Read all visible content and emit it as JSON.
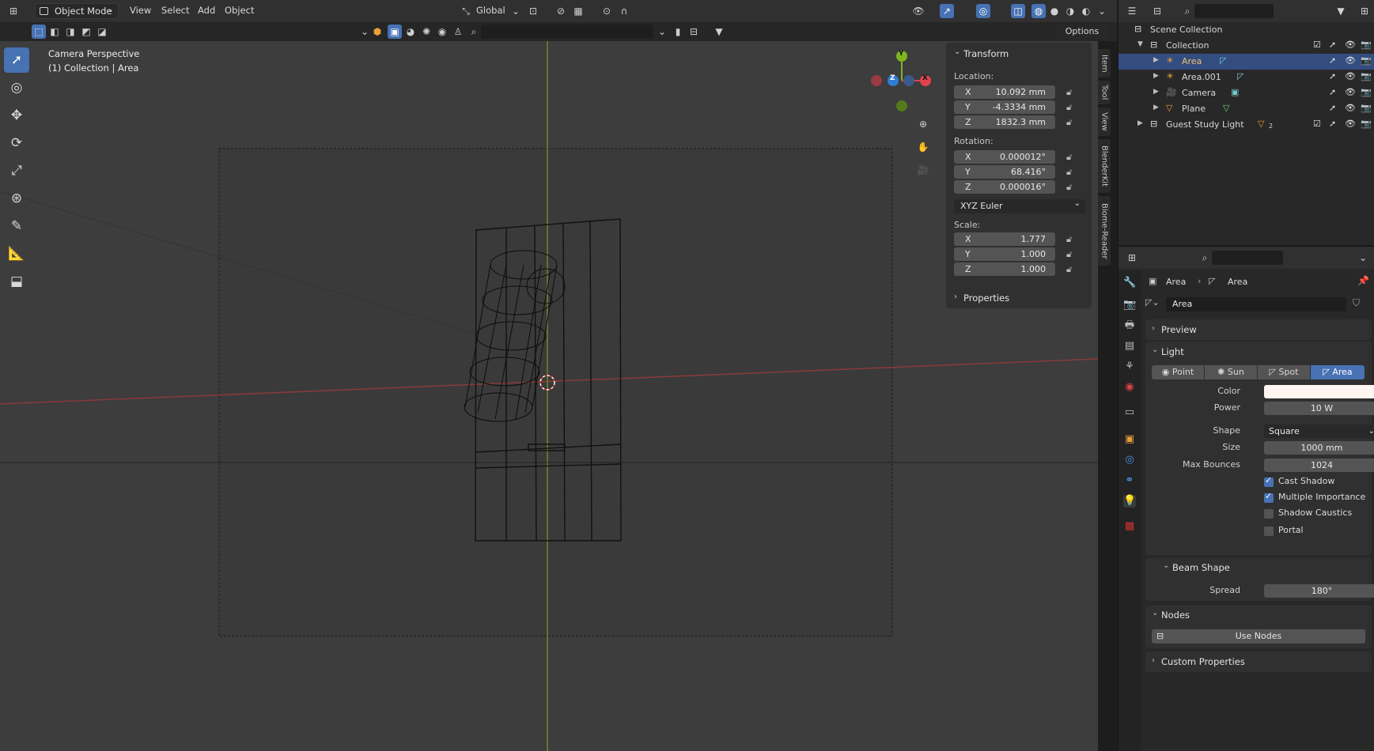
{
  "header": {
    "mode": "Object Mode",
    "menus": [
      "View",
      "Select",
      "Add",
      "Object"
    ],
    "orientation": "Global",
    "options": "Options"
  },
  "viewport": {
    "camera_label": "Camera Perspective",
    "collection_label": "(1) Collection | Area",
    "gizmo": {
      "y": "Y",
      "z": "Z",
      "x": "X"
    }
  },
  "npanel": {
    "transform_title": "Transform",
    "location_label": "Location:",
    "location": [
      {
        "axis": "X",
        "value": "10.092 mm"
      },
      {
        "axis": "Y",
        "value": "-4.3334 mm"
      },
      {
        "axis": "Z",
        "value": "1832.3 mm"
      }
    ],
    "rotation_label": "Rotation:",
    "rotation": [
      {
        "axis": "X",
        "value": "0.000012°"
      },
      {
        "axis": "Y",
        "value": "68.416°"
      },
      {
        "axis": "Z",
        "value": "0.000016°"
      }
    ],
    "rotation_mode": "XYZ Euler",
    "scale_label": "Scale:",
    "scale": [
      {
        "axis": "X",
        "value": "1.777"
      },
      {
        "axis": "Y",
        "value": "1.000"
      },
      {
        "axis": "Z",
        "value": "1.000"
      }
    ],
    "properties_title": "Properties",
    "tabs": [
      "Item",
      "Tool",
      "View",
      "BlenderKit",
      "Biome-Reader"
    ]
  },
  "outliner": {
    "scene_collection": "Scene Collection",
    "items": [
      {
        "name": "Collection"
      },
      {
        "name": "Area"
      },
      {
        "name": "Area.001"
      },
      {
        "name": "Camera"
      },
      {
        "name": "Plane"
      },
      {
        "name": "Guest Study Light",
        "count": "2"
      }
    ]
  },
  "properties": {
    "breadcrumb_1": "Area",
    "breadcrumb_2": "Area",
    "datablock": "Area",
    "preview": "Preview",
    "light": "Light",
    "light_types": [
      "Point",
      "Sun",
      "Spot",
      "Area"
    ],
    "color_label": "Color",
    "power_label": "Power",
    "power": "10 W",
    "shape_label": "Shape",
    "shape": "Square",
    "size_label": "Size",
    "size": "1000 mm",
    "max_bounces_label": "Max Bounces",
    "max_bounces": "1024",
    "cast_shadow": "Cast Shadow",
    "multiple_importance": "Multiple Importance",
    "shadow_caustics": "Shadow Caustics",
    "portal": "Portal",
    "beam_shape": "Beam Shape",
    "spread_label": "Spread",
    "spread": "180°",
    "nodes": "Nodes",
    "use_nodes": "Use Nodes",
    "custom_properties": "Custom Properties"
  }
}
